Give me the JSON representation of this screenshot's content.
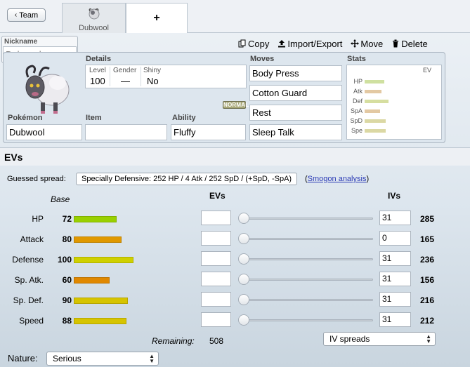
{
  "tabs": {
    "team_label": "Team",
    "active_tab": "Dubwool",
    "add_label": "+"
  },
  "nickname": {
    "label": "Nickname",
    "placeholder": "Dubwool",
    "value": ""
  },
  "actions": {
    "copy": "Copy",
    "import_export": "Import/Export",
    "move": "Move",
    "delete": "Delete"
  },
  "details": {
    "label": "Details",
    "level_label": "Level",
    "level": "100",
    "gender_label": "Gender",
    "gender": "—",
    "shiny_label": "Shiny",
    "shiny": "No"
  },
  "type_badge": "NORMAL",
  "pokemon": {
    "label": "Pokémon",
    "value": "Dubwool"
  },
  "item": {
    "label": "Item",
    "value": ""
  },
  "ability": {
    "label": "Ability",
    "value": "Fluffy"
  },
  "moves": {
    "label": "Moves",
    "list": [
      "Body Press",
      "Cotton Guard",
      "Rest",
      "Sleep Talk"
    ]
  },
  "stats_panel": {
    "label": "Stats",
    "ev_label": "EV",
    "rows": [
      "HP",
      "Atk",
      "Def",
      "SpA",
      "SpD",
      "Spe"
    ]
  },
  "evs": {
    "section_title": "EVs",
    "guessed_label": "Guessed spread:",
    "guessed_value": "Specially Defensive: 252 HP / 4 Atk / 252 SpD / (+SpD, -SpA)",
    "smogon_open": "(",
    "smogon_link": "Smogon analysis",
    "smogon_close": ")",
    "base_header": "Base",
    "evs_header": "EVs",
    "ivs_header": "IVs",
    "rows": [
      {
        "name": "HP",
        "base": 72,
        "ev": "",
        "iv": "31",
        "total": "285",
        "color": "#99d000"
      },
      {
        "name": "Attack",
        "base": 80,
        "ev": "",
        "iv": "0",
        "total": "165",
        "color": "#e09800"
      },
      {
        "name": "Defense",
        "base": 100,
        "ev": "",
        "iv": "31",
        "total": "236",
        "color": "#cfd000"
      },
      {
        "name": "Sp. Atk.",
        "base": 60,
        "ev": "",
        "iv": "31",
        "total": "156",
        "color": "#e08800"
      },
      {
        "name": "Sp. Def.",
        "base": 90,
        "ev": "",
        "iv": "31",
        "total": "216",
        "color": "#d6c400"
      },
      {
        "name": "Speed",
        "base": 88,
        "ev": "",
        "iv": "31",
        "total": "212",
        "color": "#d6c400"
      }
    ],
    "remaining_label": "Remaining:",
    "remaining_value": "508",
    "iv_spreads": "IV spreads"
  },
  "nature": {
    "label": "Nature:",
    "value": "Serious"
  }
}
